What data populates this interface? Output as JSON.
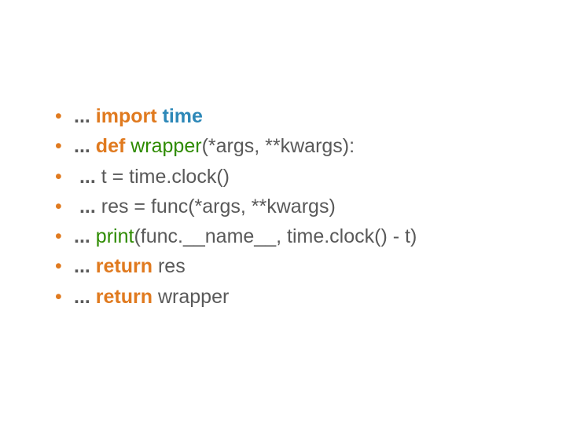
{
  "lines": [
    {
      "indent": "",
      "segments": [
        {
          "cls": "ellipsis",
          "text": "..."
        },
        {
          "cls": "plain",
          "text": " "
        },
        {
          "cls": "kw-import",
          "text": "import "
        },
        {
          "cls": "module",
          "text": "time"
        }
      ]
    },
    {
      "indent": "",
      "segments": [
        {
          "cls": "ellipsis",
          "text": "..."
        },
        {
          "cls": "plain",
          "text": " "
        },
        {
          "cls": "kw-def",
          "text": "def "
        },
        {
          "cls": "fn-name",
          "text": "wrapper"
        },
        {
          "cls": "plain",
          "text": "(*args, **kwargs):"
        }
      ]
    },
    {
      "indent": " ",
      "segments": [
        {
          "cls": "ellipsis",
          "text": "..."
        },
        {
          "cls": "plain",
          "text": " t = time.clock()"
        }
      ]
    },
    {
      "indent": " ",
      "segments": [
        {
          "cls": "ellipsis",
          "text": "..."
        },
        {
          "cls": "plain",
          "text": " res = func(*args, **kwargs)"
        }
      ]
    },
    {
      "indent": "",
      "segments": [
        {
          "cls": "ellipsis",
          "text": "..."
        },
        {
          "cls": "plain",
          "text": " "
        },
        {
          "cls": "fn-call",
          "text": "print"
        },
        {
          "cls": "plain",
          "text": "(func.__name__, time.clock() - t)"
        }
      ]
    },
    {
      "indent": "",
      "segments": [
        {
          "cls": "ellipsis",
          "text": "..."
        },
        {
          "cls": "plain",
          "text": " "
        },
        {
          "cls": "kw-return",
          "text": "return "
        },
        {
          "cls": "plain",
          "text": "res"
        }
      ]
    },
    {
      "indent": "",
      "segments": [
        {
          "cls": "ellipsis",
          "text": "..."
        },
        {
          "cls": "plain",
          "text": " "
        },
        {
          "cls": "kw-return",
          "text": "return "
        },
        {
          "cls": "plain",
          "text": "wrapper"
        }
      ]
    }
  ]
}
